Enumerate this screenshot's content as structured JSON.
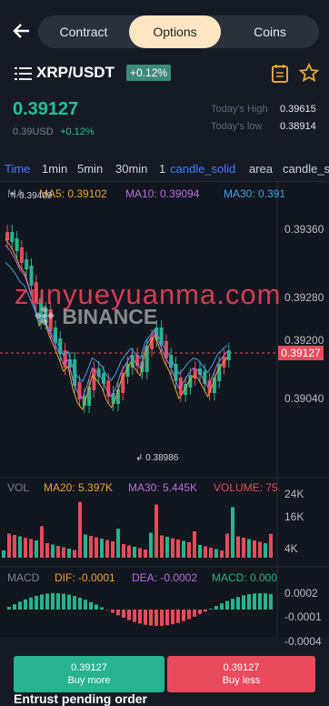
{
  "nav": {
    "back_icon": "arrow-left-icon",
    "tabs": [
      "Contract",
      "Options",
      "Coins"
    ],
    "active": "Options"
  },
  "pair": {
    "menu_icon": "list-icon",
    "symbol": "XRP/USDT",
    "change_badge": "+0.12%",
    "note_icon": "notepad-icon",
    "star_icon": "star-icon"
  },
  "ticker": {
    "price": "0.39127",
    "usd": "0.39USD",
    "usd_change": "+0.12%",
    "high_label": "Today's High",
    "high": "0.39615",
    "low_label": "Today's low",
    "low": "0.38914"
  },
  "timeframes": [
    "Time",
    "1min",
    "5min",
    "30min",
    "1",
    "candle_solid",
    "area",
    "candle_s"
  ],
  "ma_legend": {
    "label": "MA",
    "ma5": "MA5: 0.39102",
    "ma10": "MA10: 0.39094",
    "ma30": "MA30: 0.391"
  },
  "price_axis": [
    "0.39360",
    "0.39280",
    "0.39200",
    "0.39040"
  ],
  "current_price_tag": "0.39127",
  "annotations": {
    "high": "0.39409",
    "low": "0.38986"
  },
  "vol_legend": {
    "label": "VOL",
    "ma20": "MA20: 5.397K",
    "ma30": "MA30: 5.445K",
    "volume": "VOLUME: 75"
  },
  "vol_axis": [
    "24K",
    "16K",
    "4K"
  ],
  "macd_legend": {
    "label": "MACD",
    "dif": "DIF: -0.0001",
    "dea": "DEA: -0.0002",
    "macd": "MACD: 0.000"
  },
  "macd_axis": [
    "0.0002",
    "-0.0001",
    "-0.0004"
  ],
  "watermark": "zunyueyuanma.com",
  "brand_logo": "BINANCE",
  "actions": {
    "buy_price": "0.39127",
    "buy_label": "Buy more",
    "sell_price": "0.39127",
    "sell_label": "Buy less"
  },
  "entrust": "Entrust pending order",
  "colors": {
    "up": "#26b38e",
    "down": "#e84b5b",
    "accent": "#3f7cff",
    "ma5": "#f0a431",
    "ma10": "#b46fe0",
    "ma30": "#3ea2e8"
  }
}
